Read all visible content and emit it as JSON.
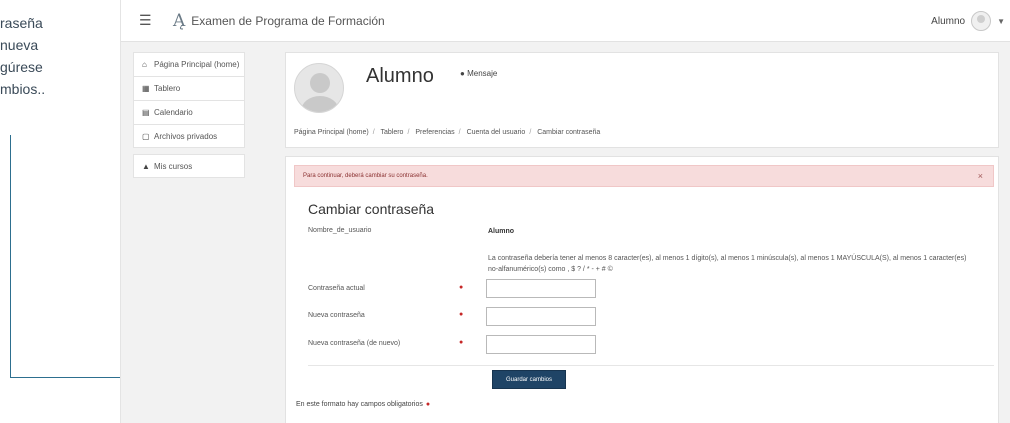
{
  "annotation": {
    "lines": [
      "raseña",
      "nueva",
      "gúrese",
      "mbios.."
    ]
  },
  "navbar": {
    "menu_icon": "hamburger-icon",
    "brand_title": "Examen de Programa de Formación",
    "user_name": "Alumno"
  },
  "sidebar": {
    "items": [
      {
        "label": "Página Principal (home)",
        "icon": "home-icon"
      },
      {
        "label": "Tablero",
        "icon": "dashboard-icon"
      },
      {
        "label": "Calendario",
        "icon": "calendar-icon"
      },
      {
        "label": "Archivos privados",
        "icon": "file-icon"
      },
      {
        "label": "Mis cursos",
        "icon": "graduation-cap-icon"
      }
    ]
  },
  "profile": {
    "name": "Alumno",
    "message_label": "Mensaje"
  },
  "breadcrumb": [
    "Página Principal (home)",
    "Tablero",
    "Preferencias",
    "Cuenta del usuario",
    "Cambiar contraseña"
  ],
  "form": {
    "alert_text": "Para continuar, deberá cambiar su contraseña.",
    "alert_close": "×",
    "title": "Cambiar contraseña",
    "username_label": "Nombre_de_usuario",
    "username_value": "Alumno",
    "policy_text": "La contraseña debería tener al menos 8 caracter(es), al menos 1 dígito(s), al menos 1 minúscula(s), al menos 1 MAYÚSCULA(S), al menos 1 caracter(es) no-alfanumérico(s) como , $ ? / * - + # ©",
    "current_label": "Contraseña actual",
    "new_label": "Nueva contraseña",
    "new_again_label": "Nueva contraseña (de nuevo)",
    "save_label": "Guardar cambios",
    "required_note": "En este formato hay campos obligatorios"
  },
  "colors": {
    "primary_button": "#1f4466",
    "alert_bg": "#f7dcdc",
    "required": "#c62828",
    "callout_line": "#2d6f8f"
  }
}
